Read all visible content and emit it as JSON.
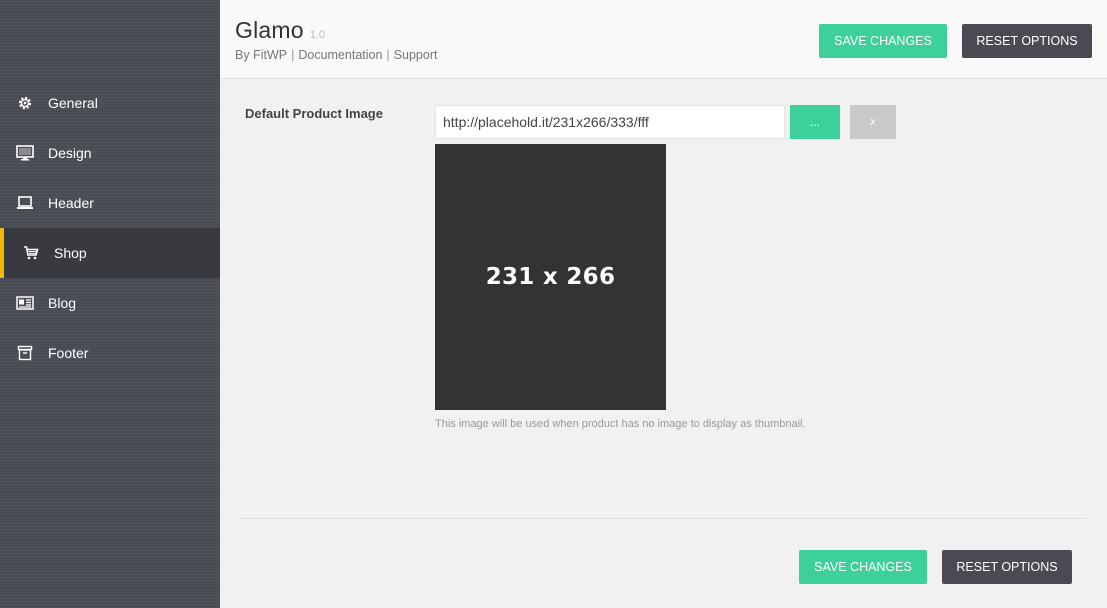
{
  "app": {
    "title": "Glamo",
    "version": "1.0",
    "byline": {
      "author": "By FitWP",
      "documentation": "Documentation",
      "support": "Support",
      "separator": "|"
    }
  },
  "toolbar": {
    "save_label": "SAVE CHANGES",
    "reset_label": "RESET OPTIONS"
  },
  "sidebar": {
    "items": [
      {
        "label": "General",
        "icon": "gear-icon"
      },
      {
        "label": "Design",
        "icon": "monitor-icon"
      },
      {
        "label": "Header",
        "icon": "laptop-icon"
      },
      {
        "label": "Shop",
        "icon": "cart-icon",
        "active": true
      },
      {
        "label": "Blog",
        "icon": "newspaper-icon"
      },
      {
        "label": "Footer",
        "icon": "archive-icon"
      }
    ],
    "accent_color": "#f5b800"
  },
  "field": {
    "label": "Default Product Image",
    "value": "http://placehold.it/231x266/333/fff",
    "browse_label": "...",
    "clear_label": "x",
    "preview_text": "231 x 266",
    "description": "This image will be used when product has no image to display as thumbnail."
  },
  "footer": {
    "save_label": "SAVE CHANGES",
    "reset_label": "RESET OPTIONS"
  },
  "colors": {
    "save": "#3dd098",
    "reset": "#4a4a52",
    "sidebar": "#4a4c53"
  }
}
